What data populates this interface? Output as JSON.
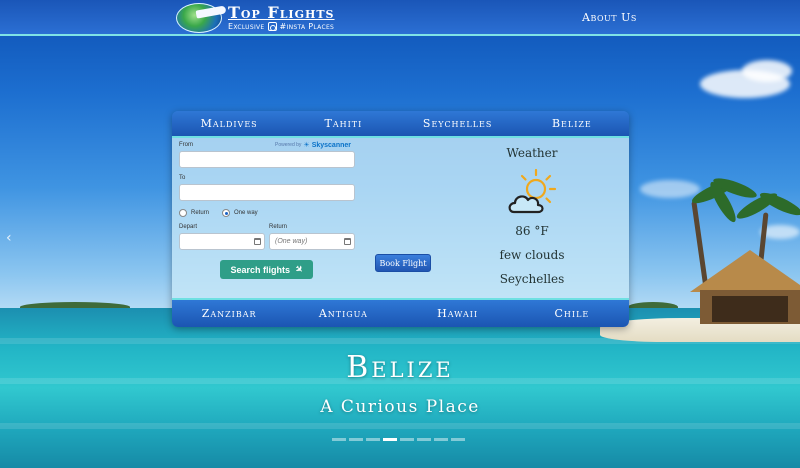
{
  "header": {
    "brand_title": "Top Flights",
    "brand_tagline_left": "Exclusive",
    "brand_tagline_right": "#insta Places",
    "about_link": "About Us"
  },
  "destinations_top": [
    "Maldives",
    "Tahiti",
    "Seychelles",
    "Belize"
  ],
  "destinations_bottom": [
    "Zanzibar",
    "Antigua",
    "Hawaii",
    "Chile"
  ],
  "search_form": {
    "powered_by_prefix": "Powered by",
    "powered_by_brand": "Skyscanner",
    "from_label": "From",
    "from_value": "",
    "to_label": "To",
    "to_value": "",
    "trip_options": [
      "Return",
      "One way"
    ],
    "selected_trip": "One way",
    "depart_label": "Depart",
    "depart_value": "",
    "return_label": "Return",
    "return_placeholder": "(One way)",
    "search_button": "Search flights"
  },
  "book_button": "Book Flight",
  "weather": {
    "title": "Weather",
    "icon": "partly-cloudy-icon",
    "temperature": "86 °F",
    "condition": "few clouds",
    "location": "Seychelles"
  },
  "hero": {
    "title": "Belize",
    "subtitle": "A Curious Place"
  },
  "carousel": {
    "slide_count": 8,
    "active_index": 3
  },
  "colors": {
    "header_blue": "#1a56b8",
    "accent_cyan": "#7fe3e5",
    "search_green": "#2f9e88",
    "book_blue": "#2156b3"
  }
}
